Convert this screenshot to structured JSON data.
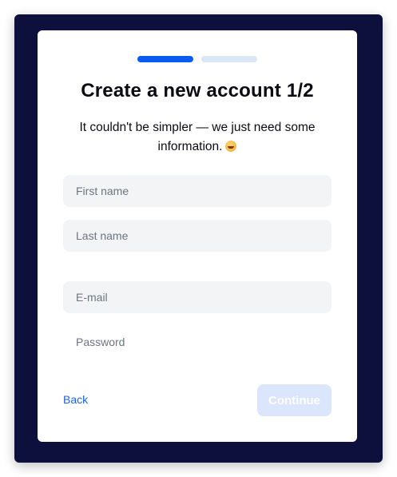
{
  "signup": {
    "progress": {
      "total_steps": 2,
      "current_step": 1
    },
    "title": "Create a new account 1/2",
    "subtitle": "It couldn't be simpler — we just need some information.",
    "emoji_icon": "grinning-face-icon",
    "fields": {
      "first_name_placeholder": "First name",
      "last_name_placeholder": "Last name",
      "email_placeholder": "E-mail",
      "password_placeholder": "Password"
    },
    "back_label": "Back",
    "continue_label": "Continue"
  },
  "colors": {
    "frame_background": "#0d0f3c",
    "accent": "#0a5cf0",
    "progress_inactive": "#dce6f9",
    "link": "#1c63e8",
    "button_disabled": "#dbe5fb",
    "field_background": "#f3f4f6"
  }
}
